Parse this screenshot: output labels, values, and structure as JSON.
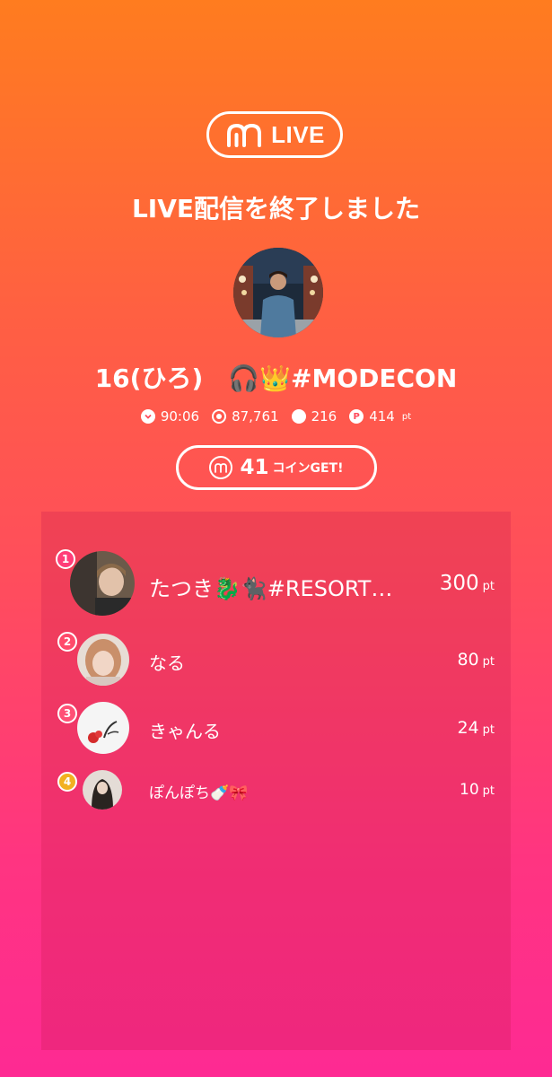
{
  "header": {
    "logo_text": "LIVE",
    "title": "LIVE配信を終了しました"
  },
  "host": {
    "name": "16(ひろ)　🎧👑#MODECON"
  },
  "stats": [
    {
      "icon": "chevron-down-circle-icon",
      "value": "90:06"
    },
    {
      "icon": "viewers-icon",
      "value": "87,761"
    },
    {
      "icon": "comment-icon",
      "value": "216"
    },
    {
      "icon": "points-icon",
      "value": "414",
      "unit": "pt"
    }
  ],
  "coins": {
    "value": "41",
    "label": "コインGET!"
  },
  "ranking": [
    {
      "rank": "1",
      "name": "たつき🐉🐈‍⬛#RESORT…",
      "points": "300",
      "unit": "pt"
    },
    {
      "rank": "2",
      "name": "なる",
      "points": "80",
      "unit": "pt"
    },
    {
      "rank": "3",
      "name": "きゃんる",
      "points": "24",
      "unit": "pt"
    },
    {
      "rank": "4",
      "name": "ぽんぽち🍼🎀",
      "points": "10",
      "unit": "pt"
    }
  ],
  "colors": {
    "rank1": "#ff3d78",
    "rank2": "#ff4a6a",
    "rank3": "#ff5076",
    "rank4": "#f2b01f"
  }
}
